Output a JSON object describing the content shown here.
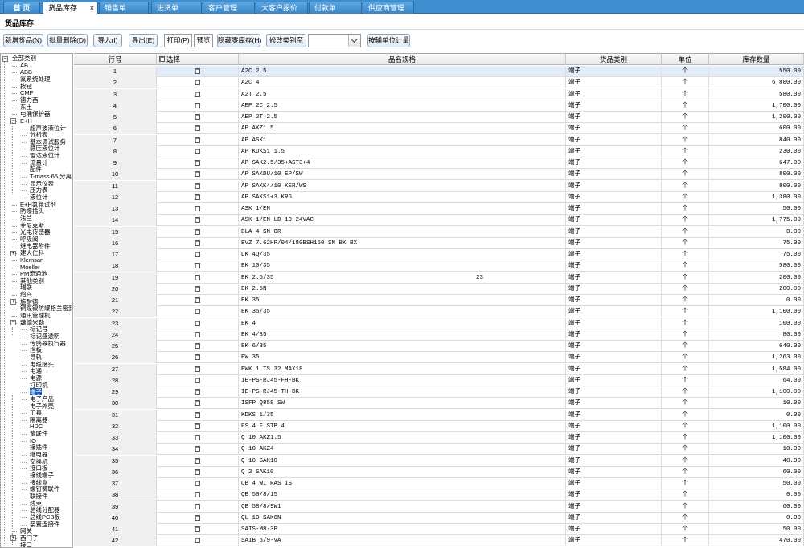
{
  "tabs": [
    {
      "label": "首 页"
    },
    {
      "label": "货品库存",
      "close": "×"
    },
    {
      "label": "销售单"
    },
    {
      "label": "进货单"
    },
    {
      "label": "客户管理"
    },
    {
      "label": "大客户报价"
    },
    {
      "label": "付款单"
    },
    {
      "label": "供应商管理"
    }
  ],
  "page_title": "货品库存",
  "toolbar": {
    "new": "新增货品(N)",
    "batch_delete": "批量删除(D)",
    "import": "导入(I)",
    "export": "导出(E)",
    "print": "打印(P)",
    "preview": "预览",
    "hide_zero": "隐藏零库存(H)",
    "change_type": "修改类别至",
    "type_value": "",
    "aux_unit": "按辅单位计量"
  },
  "tree": [
    {
      "label": "全部类别",
      "level": 0,
      "exp": "−"
    },
    {
      "label": "AB",
      "level": 1
    },
    {
      "label": "ABB",
      "level": 1
    },
    {
      "label": "氟系统处理",
      "level": 1
    },
    {
      "label": "按钮",
      "level": 1
    },
    {
      "label": "CMP",
      "level": 1
    },
    {
      "label": "德力西",
      "level": 1
    },
    {
      "label": "东土",
      "level": 1
    },
    {
      "label": "电涌保护器",
      "level": 1
    },
    {
      "label": "E+H",
      "level": 1,
      "exp": "−"
    },
    {
      "label": "超声波液位计",
      "level": 2
    },
    {
      "label": "分析表",
      "level": 2
    },
    {
      "label": "基本调试服务",
      "level": 2
    },
    {
      "label": "静压液位计",
      "level": 2
    },
    {
      "label": "雷达液位计",
      "level": 2
    },
    {
      "label": "流量计",
      "level": 2
    },
    {
      "label": "配件",
      "level": 2
    },
    {
      "label": "T-mass 65 分离",
      "level": 2
    },
    {
      "label": "显示仪表",
      "level": 2
    },
    {
      "label": "压力表",
      "level": 2
    },
    {
      "label": "液位计",
      "level": 2
    },
    {
      "label": "E+H氯氛试剂",
      "level": 1
    },
    {
      "label": "防爆插头",
      "level": 1
    },
    {
      "label": "法兰",
      "level": 1
    },
    {
      "label": "菲尼克斯",
      "level": 1
    },
    {
      "label": "光电传感器",
      "level": 1
    },
    {
      "label": "呼吸阀",
      "level": 1
    },
    {
      "label": "继电器附件",
      "level": 1
    },
    {
      "label": "建大仁科",
      "level": 1,
      "exp": "+"
    },
    {
      "label": "Klemsan",
      "level": 1
    },
    {
      "label": "Moeller",
      "level": 1
    },
    {
      "label": "PM流通池",
      "level": 1
    },
    {
      "label": "其他类别",
      "level": 1
    },
    {
      "label": "瑞联",
      "level": 1
    },
    {
      "label": "绍兴",
      "level": 1
    },
    {
      "label": "施耐德",
      "level": 1,
      "exp": "+"
    },
    {
      "label": "铜缆镍防爆格兰密封",
      "level": 1
    },
    {
      "label": "通讯管理机",
      "level": 1
    },
    {
      "label": "魏德米勒",
      "level": 1,
      "exp": "−"
    },
    {
      "label": "标记号",
      "level": 2
    },
    {
      "label": "标记盛透明",
      "level": 2
    },
    {
      "label": "传感器执行器",
      "level": 2
    },
    {
      "label": "挡板",
      "level": 2
    },
    {
      "label": "导轨",
      "level": 2
    },
    {
      "label": "电缆接头",
      "level": 2
    },
    {
      "label": "电通",
      "level": 2
    },
    {
      "label": "电源",
      "level": 2
    },
    {
      "label": "打印机",
      "level": 2
    },
    {
      "label": "端子",
      "level": 2,
      "sel": true
    },
    {
      "label": "电子产品",
      "level": 2
    },
    {
      "label": "电子外壳",
      "level": 2
    },
    {
      "label": "工具",
      "level": 2
    },
    {
      "label": "隔离器",
      "level": 2
    },
    {
      "label": "HDC",
      "level": 2
    },
    {
      "label": "簧联件",
      "level": 2
    },
    {
      "label": "IO",
      "level": 2
    },
    {
      "label": "接插件",
      "level": 2
    },
    {
      "label": "继电器",
      "level": 2
    },
    {
      "label": "交换机",
      "level": 2
    },
    {
      "label": "接口板",
      "level": 2
    },
    {
      "label": "接线端子",
      "level": 2
    },
    {
      "label": "接线盒",
      "level": 2
    },
    {
      "label": "螺钉簧联件",
      "level": 2
    },
    {
      "label": "联接件",
      "level": 2
    },
    {
      "label": "线束",
      "level": 2
    },
    {
      "label": "总线分配器",
      "level": 2
    },
    {
      "label": "总线PCB板",
      "level": 2
    },
    {
      "label": "装置连接件",
      "level": 2
    },
    {
      "label": "网关",
      "level": 1
    },
    {
      "label": "西门子",
      "level": 1,
      "exp": "+"
    },
    {
      "label": "接口",
      "level": 1
    }
  ],
  "grid": {
    "headers": [
      "行号",
      "选择",
      "品名规格",
      "货品类别",
      "单位",
      "库存数量"
    ],
    "rows": [
      {
        "no": "1",
        "name": "A2C 2.5",
        "type": "端子",
        "unit": "个",
        "qty": "550.00"
      },
      {
        "no": "2",
        "name": "A2C 4",
        "type": "端子",
        "unit": "个",
        "qty": "6,800.00"
      },
      {
        "no": "3",
        "name": "A2T 2.5",
        "type": "端子",
        "unit": "个",
        "qty": "580.00"
      },
      {
        "no": "4",
        "name": "AEP 2C 2.5",
        "type": "端子",
        "unit": "个",
        "qty": "1,700.00"
      },
      {
        "no": "5",
        "name": "AEP 2T 2.5",
        "type": "端子",
        "unit": "个",
        "qty": "1,200.00"
      },
      {
        "no": "6",
        "name": "AP AKZ1.5",
        "type": "端子",
        "unit": "个",
        "qty": "600.00"
      },
      {
        "no": "7",
        "name": "AP ASK1",
        "type": "端子",
        "unit": "个",
        "qty": "840.00"
      },
      {
        "no": "8",
        "name": "AP KDKS1 1.5",
        "type": "端子",
        "unit": "个",
        "qty": "230.00"
      },
      {
        "no": "9",
        "name": "AP SAK2.5/35+AST3+4",
        "type": "端子",
        "unit": "个",
        "qty": "647.00"
      },
      {
        "no": "10",
        "name": "AP SAKDU/10 EP/SW",
        "type": "端子",
        "unit": "个",
        "qty": "800.00"
      },
      {
        "no": "11",
        "name": "AP SAKK4/10 KER/WS",
        "type": "端子",
        "unit": "个",
        "qty": "800.00"
      },
      {
        "no": "12",
        "name": "AP SAKS1+3 KRG",
        "type": "端子",
        "unit": "个",
        "qty": "1,380.00"
      },
      {
        "no": "13",
        "name": "ASK 1/EN",
        "type": "端子",
        "unit": "个",
        "qty": "50.00"
      },
      {
        "no": "14",
        "name": "ASK 1/EN LD 1D 24VAC",
        "type": "端子",
        "unit": "个",
        "qty": "1,775.00"
      },
      {
        "no": "15",
        "name": "BLA 4 SN OR",
        "type": "端子",
        "unit": "个",
        "qty": "0.00"
      },
      {
        "no": "16",
        "name": "BVZ 7.62HP/04/180BSH160 SN BK BX",
        "type": "端子",
        "unit": "个",
        "qty": "75.00"
      },
      {
        "no": "17",
        "name": "DK 4Q/35",
        "type": "端子",
        "unit": "个",
        "qty": "75.00"
      },
      {
        "no": "18",
        "name": "EK 10/35",
        "type": "端子",
        "unit": "个",
        "qty": "580.00"
      },
      {
        "no": "19",
        "name": "EK 2.5/35",
        "extra": "23",
        "type": "端子",
        "unit": "个",
        "qty": "200.00"
      },
      {
        "no": "20",
        "name": "EK 2.5N",
        "type": "端子",
        "unit": "个",
        "qty": "200.00"
      },
      {
        "no": "21",
        "name": "EK 35",
        "type": "端子",
        "unit": "个",
        "qty": "0.00"
      },
      {
        "no": "22",
        "name": "EK 35/35",
        "type": "端子",
        "unit": "个",
        "qty": "1,100.00"
      },
      {
        "no": "23",
        "name": "EK 4",
        "type": "端子",
        "unit": "个",
        "qty": "100.00"
      },
      {
        "no": "24",
        "name": "EK 4/35",
        "type": "端子",
        "unit": "个",
        "qty": "80.00"
      },
      {
        "no": "25",
        "name": "EK 6/35",
        "type": "端子",
        "unit": "个",
        "qty": "640.00"
      },
      {
        "no": "26",
        "name": "EW 35",
        "type": "端子",
        "unit": "个",
        "qty": "1,263.00"
      },
      {
        "no": "27",
        "name": "EWK 1 TS 32 MAX18",
        "type": "端子",
        "unit": "个",
        "qty": "1,584.00"
      },
      {
        "no": "28",
        "name": "IE-PS-RJ45-FH-BK",
        "type": "端子",
        "unit": "个",
        "qty": "64.00"
      },
      {
        "no": "29",
        "name": "IE-PS-RJ45-TH-BK",
        "type": "端子",
        "unit": "个",
        "qty": "1,100.00"
      },
      {
        "no": "30",
        "name": "ISFP Q858 SW",
        "type": "端子",
        "unit": "个",
        "qty": "10.00"
      },
      {
        "no": "31",
        "name": "KDKS 1/35",
        "type": "端子",
        "unit": "个",
        "qty": "0.00"
      },
      {
        "no": "32",
        "name": "PS 4 F STB 4",
        "type": "端子",
        "unit": "个",
        "qty": "1,100.00"
      },
      {
        "no": "33",
        "name": "Q 10 AKZ1.5",
        "type": "端子",
        "unit": "个",
        "qty": "1,100.00"
      },
      {
        "no": "34",
        "name": "Q 10 AKZ4",
        "type": "端子",
        "unit": "个",
        "qty": "10.00"
      },
      {
        "no": "35",
        "name": "Q 10 SAK10",
        "type": "端子",
        "unit": "个",
        "qty": "40.00"
      },
      {
        "no": "36",
        "name": "Q 2 SAK10",
        "type": "端子",
        "unit": "个",
        "qty": "60.00"
      },
      {
        "no": "37",
        "name": "QB 4 WI RAS IS",
        "type": "端子",
        "unit": "个",
        "qty": "50.00"
      },
      {
        "no": "38",
        "name": "QB 58/8/15",
        "type": "端子",
        "unit": "个",
        "qty": "0.00"
      },
      {
        "no": "39",
        "name": "QB 58/8/9W1",
        "type": "端子",
        "unit": "个",
        "qty": "60.00"
      },
      {
        "no": "40",
        "name": "QL 10 SAK6N",
        "type": "端子",
        "unit": "个",
        "qty": "0.00"
      },
      {
        "no": "41",
        "name": "SAIS-M8-3P",
        "type": "端子",
        "unit": "个",
        "qty": "50.00"
      },
      {
        "no": "42",
        "name": "SAIB 5/9-VA",
        "type": "端子",
        "unit": "个",
        "qty": "470.00"
      }
    ]
  }
}
